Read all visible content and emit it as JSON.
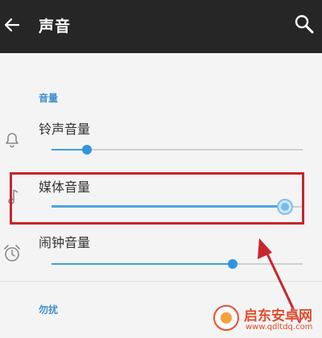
{
  "header": {
    "title": "声音",
    "back_icon": "arrow-left-icon",
    "search_icon": "search-icon"
  },
  "sections": [
    {
      "header": "音量",
      "rows": [
        {
          "label": "铃声音量",
          "icon": "bell-icon",
          "level": 0.14
        },
        {
          "label": "媒体音量",
          "icon": "music-note-icon",
          "level": 0.93,
          "highlighted": true
        },
        {
          "label": "闹钟音量",
          "icon": "alarm-clock-icon",
          "level": 0.72
        }
      ]
    },
    {
      "header": "勿扰"
    }
  ],
  "watermark": {
    "name": "启东安卓网",
    "url": "www.qdltdq.com"
  },
  "colors": {
    "appbar": "#262626",
    "accent": "#3c9fe0",
    "annotation": "#c8262b",
    "watermark": "#e14a2b"
  }
}
